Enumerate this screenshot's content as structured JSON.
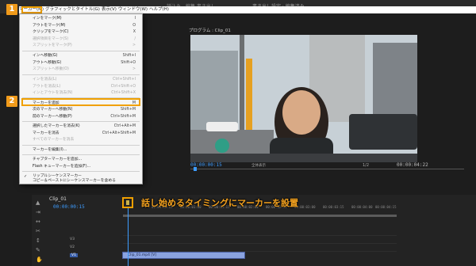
{
  "menubar": {
    "items": [
      "マーカー(M)",
      "グラフィックとタイトル(G)",
      "表示(V)",
      "ウィンドウ(W)",
      "ヘルプ(H)"
    ],
    "center_text": "読込み　編集   書き出し",
    "title_text": "書き出し設定 · 編集済み"
  },
  "badges": {
    "one": "1",
    "two": "2"
  },
  "marker_menu": {
    "items": [
      {
        "label": "インをマーク(M)",
        "shortcut": "I",
        "disabled": false
      },
      {
        "label": "アウトをマーク(M)",
        "shortcut": "O",
        "disabled": false
      },
      {
        "label": "クリップをマーク(C)",
        "shortcut": "X",
        "disabled": false
      },
      {
        "label": "選択項目をマーク(S)",
        "shortcut": "/",
        "disabled": true
      },
      {
        "label": "スプリットをマーク(P)",
        "shortcut": ">",
        "disabled": true
      },
      {
        "label": "インへ移動(G)",
        "shortcut": "Shift+I",
        "disabled": false
      },
      {
        "label": "アウトへ移動(G)",
        "shortcut": "Shift+O",
        "disabled": false
      },
      {
        "label": "スプリットへ移動(O)",
        "shortcut": ">",
        "disabled": true
      },
      {
        "label": "インを消去(L)",
        "shortcut": "Ctrl+Shift+I",
        "disabled": true
      },
      {
        "label": "アウトを消去(L)",
        "shortcut": "Ctrl+Shift+O",
        "disabled": true
      },
      {
        "label": "インとアウトを消去(N)",
        "shortcut": "Ctrl+Shift+X",
        "disabled": true
      },
      {
        "label": "マーカーを追加",
        "shortcut": "M",
        "disabled": false
      },
      {
        "label": "次のマーカーへ移動(N)",
        "shortcut": "Shift+M",
        "disabled": false
      },
      {
        "label": "前のマーカーへ移動(P)",
        "shortcut": "Ctrl+Shift+M",
        "disabled": false
      },
      {
        "label": "選択したマーカーを消去(K)",
        "shortcut": "Ctrl+Alt+M",
        "disabled": false
      },
      {
        "label": "マーカーを消去",
        "shortcut": "Ctrl+Alt+Shift+M",
        "disabled": false
      },
      {
        "label": "すべてのマーカーを消去",
        "shortcut": "",
        "disabled": true
      },
      {
        "label": "マーカーを編集(I)...",
        "shortcut": "",
        "disabled": false
      },
      {
        "label": "チャプターマーカーを追加...",
        "shortcut": "",
        "disabled": false
      },
      {
        "label": "Flash キューマーカーを追加(F)...",
        "shortcut": "",
        "disabled": false
      },
      {
        "label": "リップルシーケンスマーカー",
        "shortcut": "",
        "disabled": false,
        "checked": true
      },
      {
        "label": "コピー＆ペーストにシーケンスマーカーを含める",
        "shortcut": "",
        "disabled": false
      }
    ]
  },
  "program": {
    "title": "プログラム : Clip_01",
    "timecode": "00:00:00:15",
    "fit": "全体表示",
    "ratio": "1/2",
    "duration": "00:00:04:22"
  },
  "timeline": {
    "tab": "Clip_01",
    "timecode": "00:00:00:15",
    "ruler": [
      "00:00",
      "00:00:00:15",
      "00:00:01:00",
      "00:00:01:15",
      "00:00:02:00",
      "00:00:02:15",
      "00:00:03:00",
      "00:00:03:15",
      "00:00:04:00",
      "00:00:04:15"
    ],
    "tracks": [
      "V3",
      "V2",
      "V1"
    ],
    "clip_label": "Clip_01.mp4 [V]"
  },
  "caption": "話し始めるタイミングにマーカーを設置",
  "colors": {
    "accent": "#f09a1a",
    "timecode": "#3d9cff",
    "clip": "#8aa3e0"
  }
}
